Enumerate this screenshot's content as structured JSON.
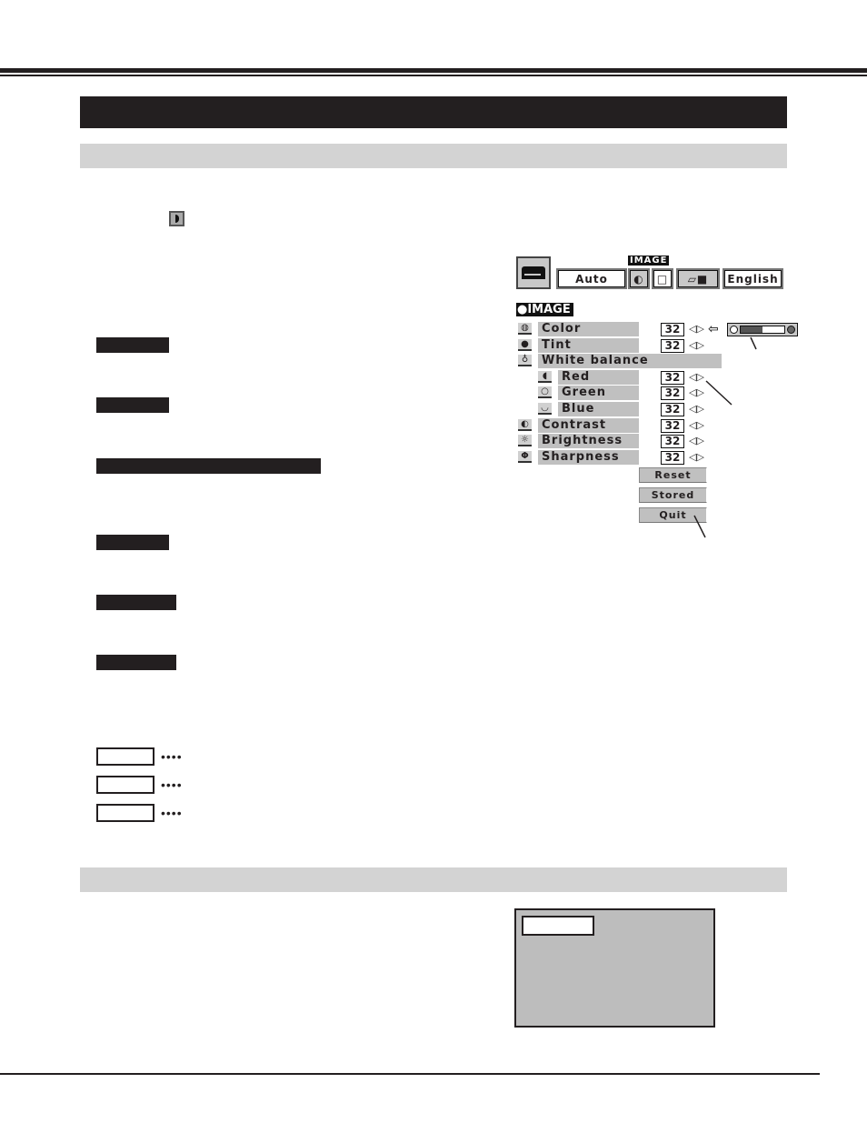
{
  "page": {
    "section_headers": [
      "",
      "",
      ""
    ],
    "dark_labels": [
      "",
      "",
      "",
      "",
      "",
      ""
    ],
    "box_labels": [
      "",
      "",
      ""
    ],
    "leader_dots": "••••"
  },
  "osd": {
    "top_bar": {
      "active_menu_tag": "IMAGE",
      "mode_value": "Auto",
      "language_value": "English",
      "icons": [
        "projector-icon",
        "image-adjust-icon",
        "screen-icon",
        "pc-adjust-icon"
      ]
    },
    "menu_title": "●IMAGE",
    "rows": [
      {
        "label": "Color",
        "value": "32",
        "icon": "color-icon",
        "sub": false
      },
      {
        "label": "Tint",
        "value": "32",
        "icon": "tint-icon",
        "sub": false
      },
      {
        "label": "White balance",
        "value": null,
        "icon": "white-balance-icon",
        "sub": false
      },
      {
        "label": "Red",
        "value": "32",
        "icon": "red-icon",
        "sub": true
      },
      {
        "label": "Green",
        "value": "32",
        "icon": "green-icon",
        "sub": true
      },
      {
        "label": "Blue",
        "value": "32",
        "icon": "blue-icon",
        "sub": true
      },
      {
        "label": "Contrast",
        "value": "32",
        "icon": "contrast-icon",
        "sub": false
      },
      {
        "label": "Brightness",
        "value": "32",
        "icon": "brightness-icon",
        "sub": false
      },
      {
        "label": "Sharpness",
        "value": "32",
        "icon": "sharpness-icon",
        "sub": false
      }
    ],
    "buttons": {
      "reset": "Reset",
      "stored": "Stored",
      "quit": "Quit"
    },
    "slider": {
      "level_fraction": 0.5
    }
  },
  "screen_example": {
    "label": ""
  }
}
